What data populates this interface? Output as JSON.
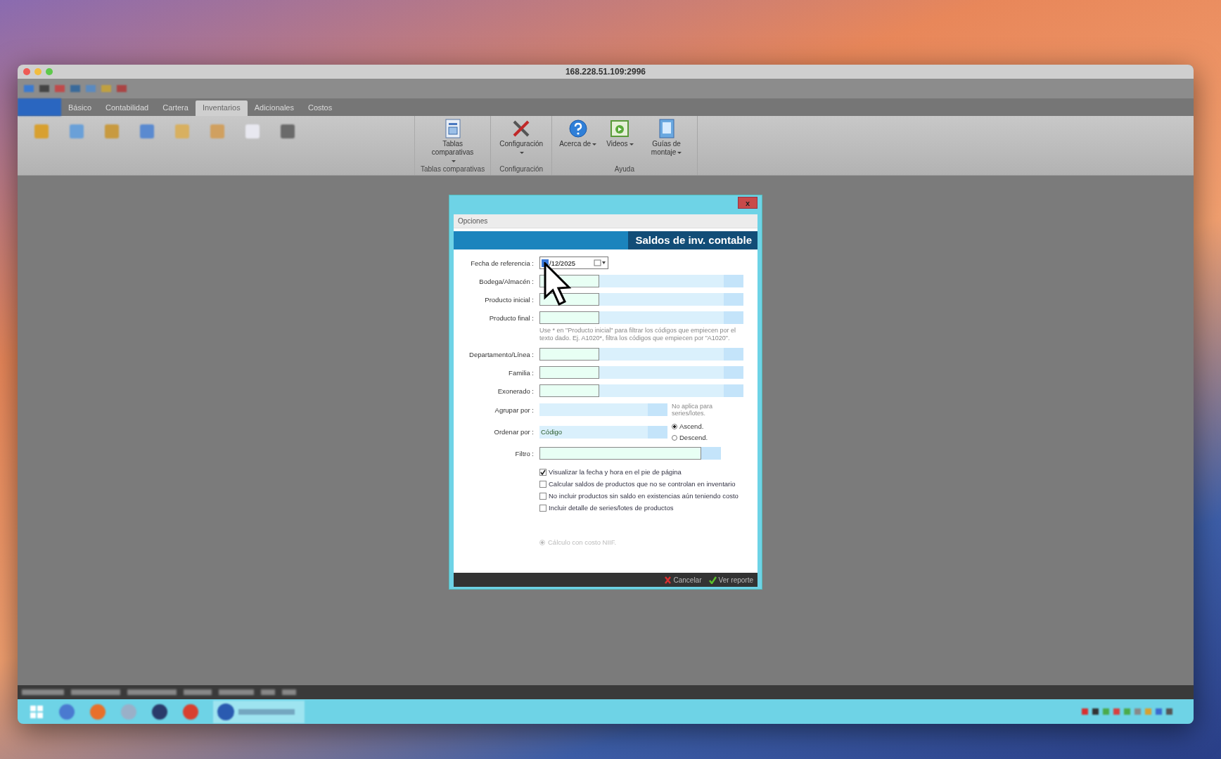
{
  "window": {
    "title": "168.228.51.109:2996"
  },
  "ribbon": {
    "tabs": [
      {
        "label": "Básico",
        "selected": false
      },
      {
        "label": "Contabilidad",
        "selected": false
      },
      {
        "label": "Cartera",
        "selected": false
      },
      {
        "label": "Inventarios",
        "selected": true
      },
      {
        "label": "Adicionales",
        "selected": false
      },
      {
        "label": "Costos",
        "selected": false
      }
    ],
    "groups": [
      {
        "label": "Tablas comparativas",
        "buttons": [
          {
            "label": "Tablas comparativas",
            "kind": "table"
          }
        ]
      },
      {
        "label": "Configuración",
        "buttons": [
          {
            "label": "Configuración",
            "kind": "tools"
          }
        ]
      },
      {
        "label": "Ayuda",
        "buttons": [
          {
            "label": "Acerca de",
            "kind": "help"
          },
          {
            "label": "Videos",
            "kind": "video"
          },
          {
            "label": "Guías de montaje",
            "kind": "guide"
          }
        ]
      }
    ]
  },
  "dialog": {
    "close": "x",
    "section": "Opciones",
    "title": "Saldos de inv. contable",
    "fields": [
      {
        "label": "Fecha de referencia :",
        "kind": "date",
        "value": "/12/2025"
      },
      {
        "label": "Bodega/Almacén :",
        "kind": "lookup"
      },
      {
        "label": "Producto inicial :",
        "kind": "lookup"
      },
      {
        "label": "Producto final :",
        "kind": "lookup"
      },
      {
        "kind": "hint",
        "text": "Use * en \"Producto inicial\" para filtrar los códigos que empiecen por el texto dado. Ej. A1020*, filtra los códigos que empiecen por \"A1020\"."
      },
      {
        "label": "Departamento/Línea :",
        "kind": "lookup"
      },
      {
        "label": "Familia :",
        "kind": "lookup"
      },
      {
        "label": "Exonerado :",
        "kind": "lookup"
      },
      {
        "label": "Agrupar por :",
        "kind": "select",
        "note": "No aplica para series/lotes."
      },
      {
        "label": "Ordenar por :",
        "kind": "select",
        "value": "Código",
        "options": [
          {
            "label": "Ascend.",
            "selected": true
          },
          {
            "label": "Descend.",
            "selected": false
          }
        ]
      },
      {
        "label": "Filtro :",
        "kind": "text"
      }
    ],
    "checks": [
      {
        "label": "Visualizar la fecha y hora en el pie de página",
        "checked": true
      },
      {
        "label": "Calcular saldos de productos que no se controlan en inventario",
        "checked": false
      },
      {
        "label": "No incluir productos sin saldo en existencias aún teniendo costo",
        "checked": false
      },
      {
        "label": "Incluir detalle de series/lotes de productos",
        "checked": false
      }
    ],
    "niif": {
      "label": "Cálculo con costo NIIF.",
      "selected": true,
      "disabled": true
    },
    "buttons": [
      {
        "label": "Cancelar",
        "kind": "cancel"
      },
      {
        "label": "Ver reporte",
        "kind": "ok"
      }
    ]
  }
}
